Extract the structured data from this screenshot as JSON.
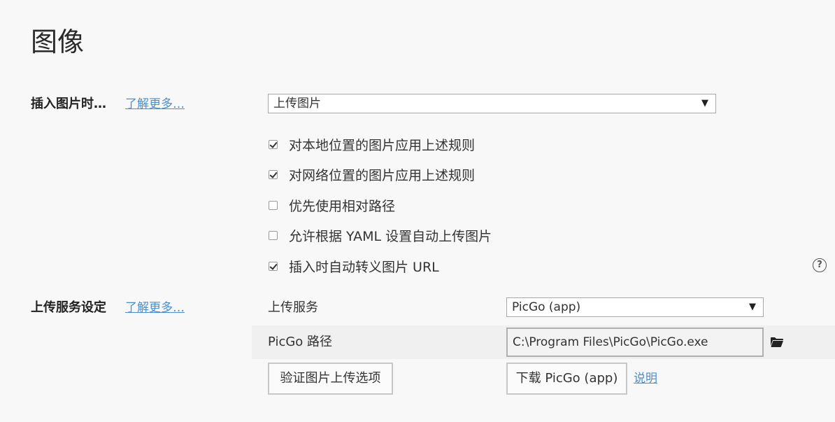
{
  "page": {
    "title": "图像"
  },
  "insert_section": {
    "label": "插入图片时…",
    "learn_more": "了解更多…",
    "action_select": {
      "value": "上传图片"
    },
    "options": [
      {
        "label": "对本地位置的图片应用上述规则",
        "checked": true
      },
      {
        "label": "对网络位置的图片应用上述规则",
        "checked": true
      },
      {
        "label": "优先使用相对路径",
        "checked": false
      },
      {
        "label": "允许根据 YAML 设置自动上传图片",
        "checked": false
      },
      {
        "label": "插入时自动转义图片 URL",
        "checked": true
      }
    ],
    "help_icon": "?"
  },
  "upload_section": {
    "label": "上传服务设定",
    "learn_more": "了解更多…",
    "service_label": "上传服务",
    "service_select": {
      "value": "PicGo (app)"
    },
    "path_label": "PicGo 路径",
    "path_value": "C:\\Program Files\\PicGo\\PicGo.exe",
    "verify_button": "验证图片上传选项",
    "download_button": "下载 PicGo (app)",
    "explain_link": "说明"
  },
  "icons": {
    "dropdown": "▼",
    "folder": "folder-icon",
    "help": "help-circle-icon"
  }
}
